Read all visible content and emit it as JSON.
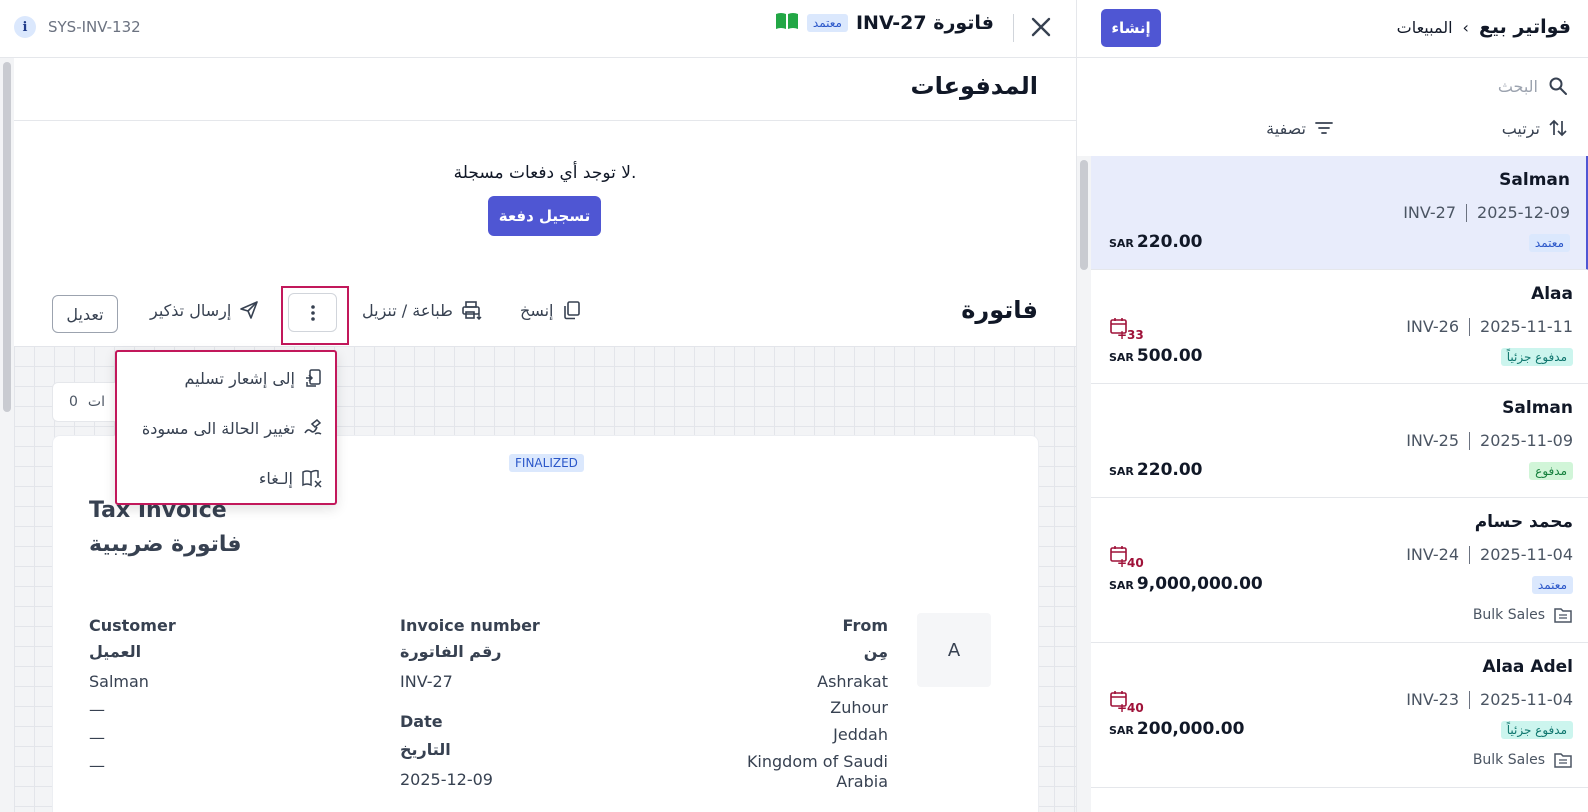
{
  "sys": {
    "code": "SYS-INV-132",
    "info_glyph": "i"
  },
  "header": {
    "title": "فاتورة INV-27",
    "status": "معتمد"
  },
  "payments": {
    "title": "المدفوعات",
    "empty_message": "لا توجد أي دفعات مسجلة.",
    "record_label": "تسجيل دفعة"
  },
  "invoice_section": {
    "title": "فاتورة",
    "copy_label": "إنسخ",
    "print_label": "طباعة / تنزيل",
    "reminder_label": "إرسال تذكير",
    "edit_label": "تعديل"
  },
  "menu": {
    "items": [
      {
        "label": "إلى إشعار تسليم"
      },
      {
        "label": "تغيير الحالة الى مسودة"
      },
      {
        "label": "إلـغاء"
      }
    ]
  },
  "preview": {
    "attachments_label": "ات",
    "attachments_count": "0",
    "finalized": "FINALIZED",
    "title_en": "Tax Invoice",
    "title_ar": "فاتورة ضريبية",
    "logo_letter": "A",
    "from_label_en": "From",
    "from_label_ar": "مِن",
    "from_lines": [
      "Ashrakat",
      "Zuhour",
      "Jeddah",
      "Kingdom of Saudi",
      "Arabia"
    ],
    "number_label_en": "Invoice number",
    "number_label_ar": "رقم الفاتورة",
    "number_value": "INV-27",
    "date_label_en": "Date",
    "date_label_ar": "التاريخ",
    "date_value": "2025-12-09",
    "customer_label_en": "Customer",
    "customer_label_ar": "العميل",
    "customer_value": "Salman",
    "customer_lines": [
      "—",
      "—",
      "—"
    ]
  },
  "sidebar": {
    "create_label": "إنشاء",
    "breadcrumb_parent": "المبيعات",
    "breadcrumb_sep": "›",
    "breadcrumb_current": "فواتير بيع",
    "search_placeholder": "البحث",
    "sort_label": "ترتيب",
    "filter_label": "تصفية",
    "currency": "SAR",
    "invoices": [
      {
        "name": "Salman",
        "date": "2025-12-09",
        "number": "INV-27",
        "amount": "220.00",
        "status": "معتمد",
        "status_type": "approved",
        "overdue": "",
        "tag": ""
      },
      {
        "name": "Alaa",
        "date": "2025-11-11",
        "number": "INV-26",
        "amount": "500.00",
        "status": "مدفوع جزئياً",
        "status_type": "partial",
        "overdue": "+33",
        "tag": ""
      },
      {
        "name": "Salman",
        "date": "2025-11-09",
        "number": "INV-25",
        "amount": "220.00",
        "status": "مدفوع",
        "status_type": "paid",
        "overdue": "",
        "tag": ""
      },
      {
        "name": "محمد حسام",
        "date": "2025-11-04",
        "number": "INV-24",
        "amount": "9,000,000.00",
        "status": "معتمد",
        "status_type": "approved",
        "overdue": "+40",
        "tag": "Bulk Sales"
      },
      {
        "name": "Alaa Adel",
        "date": "2025-11-04",
        "number": "INV-23",
        "amount": "200,000.00",
        "status": "مدفوع جزئياً",
        "status_type": "partial",
        "overdue": "+40",
        "tag": "Bulk Sales"
      }
    ]
  },
  "colors": {
    "accent": "#4f56d3",
    "highlight": "#c2185b",
    "overdue": "#9f1239"
  }
}
